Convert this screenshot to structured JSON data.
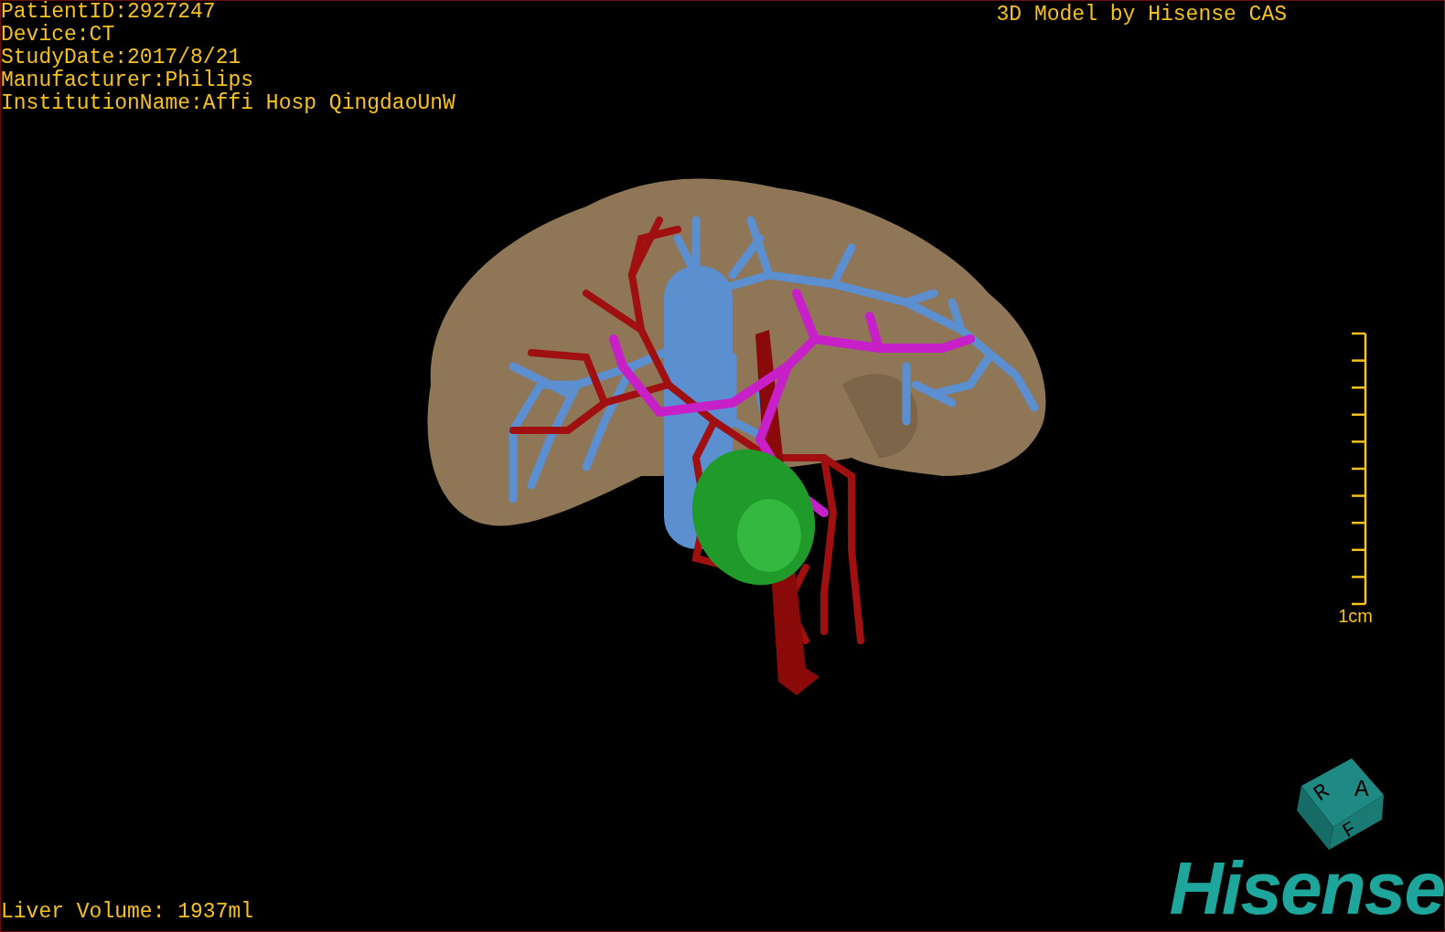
{
  "info_lines": [
    "PatientID:2927247",
    "Device:CT",
    "StudyDate:2017/8/21",
    "Manufacturer:Philips",
    "InstitutionName:Affi Hosp QingdaoUnW"
  ],
  "title": "3D Model by Hisense CAS",
  "scale_bar": {
    "label": "1cm"
  },
  "volume": "Liver Volume: 1937ml",
  "orientation_cube": {
    "faces": [
      "R",
      "A",
      "F"
    ]
  },
  "logo": "Hisense"
}
